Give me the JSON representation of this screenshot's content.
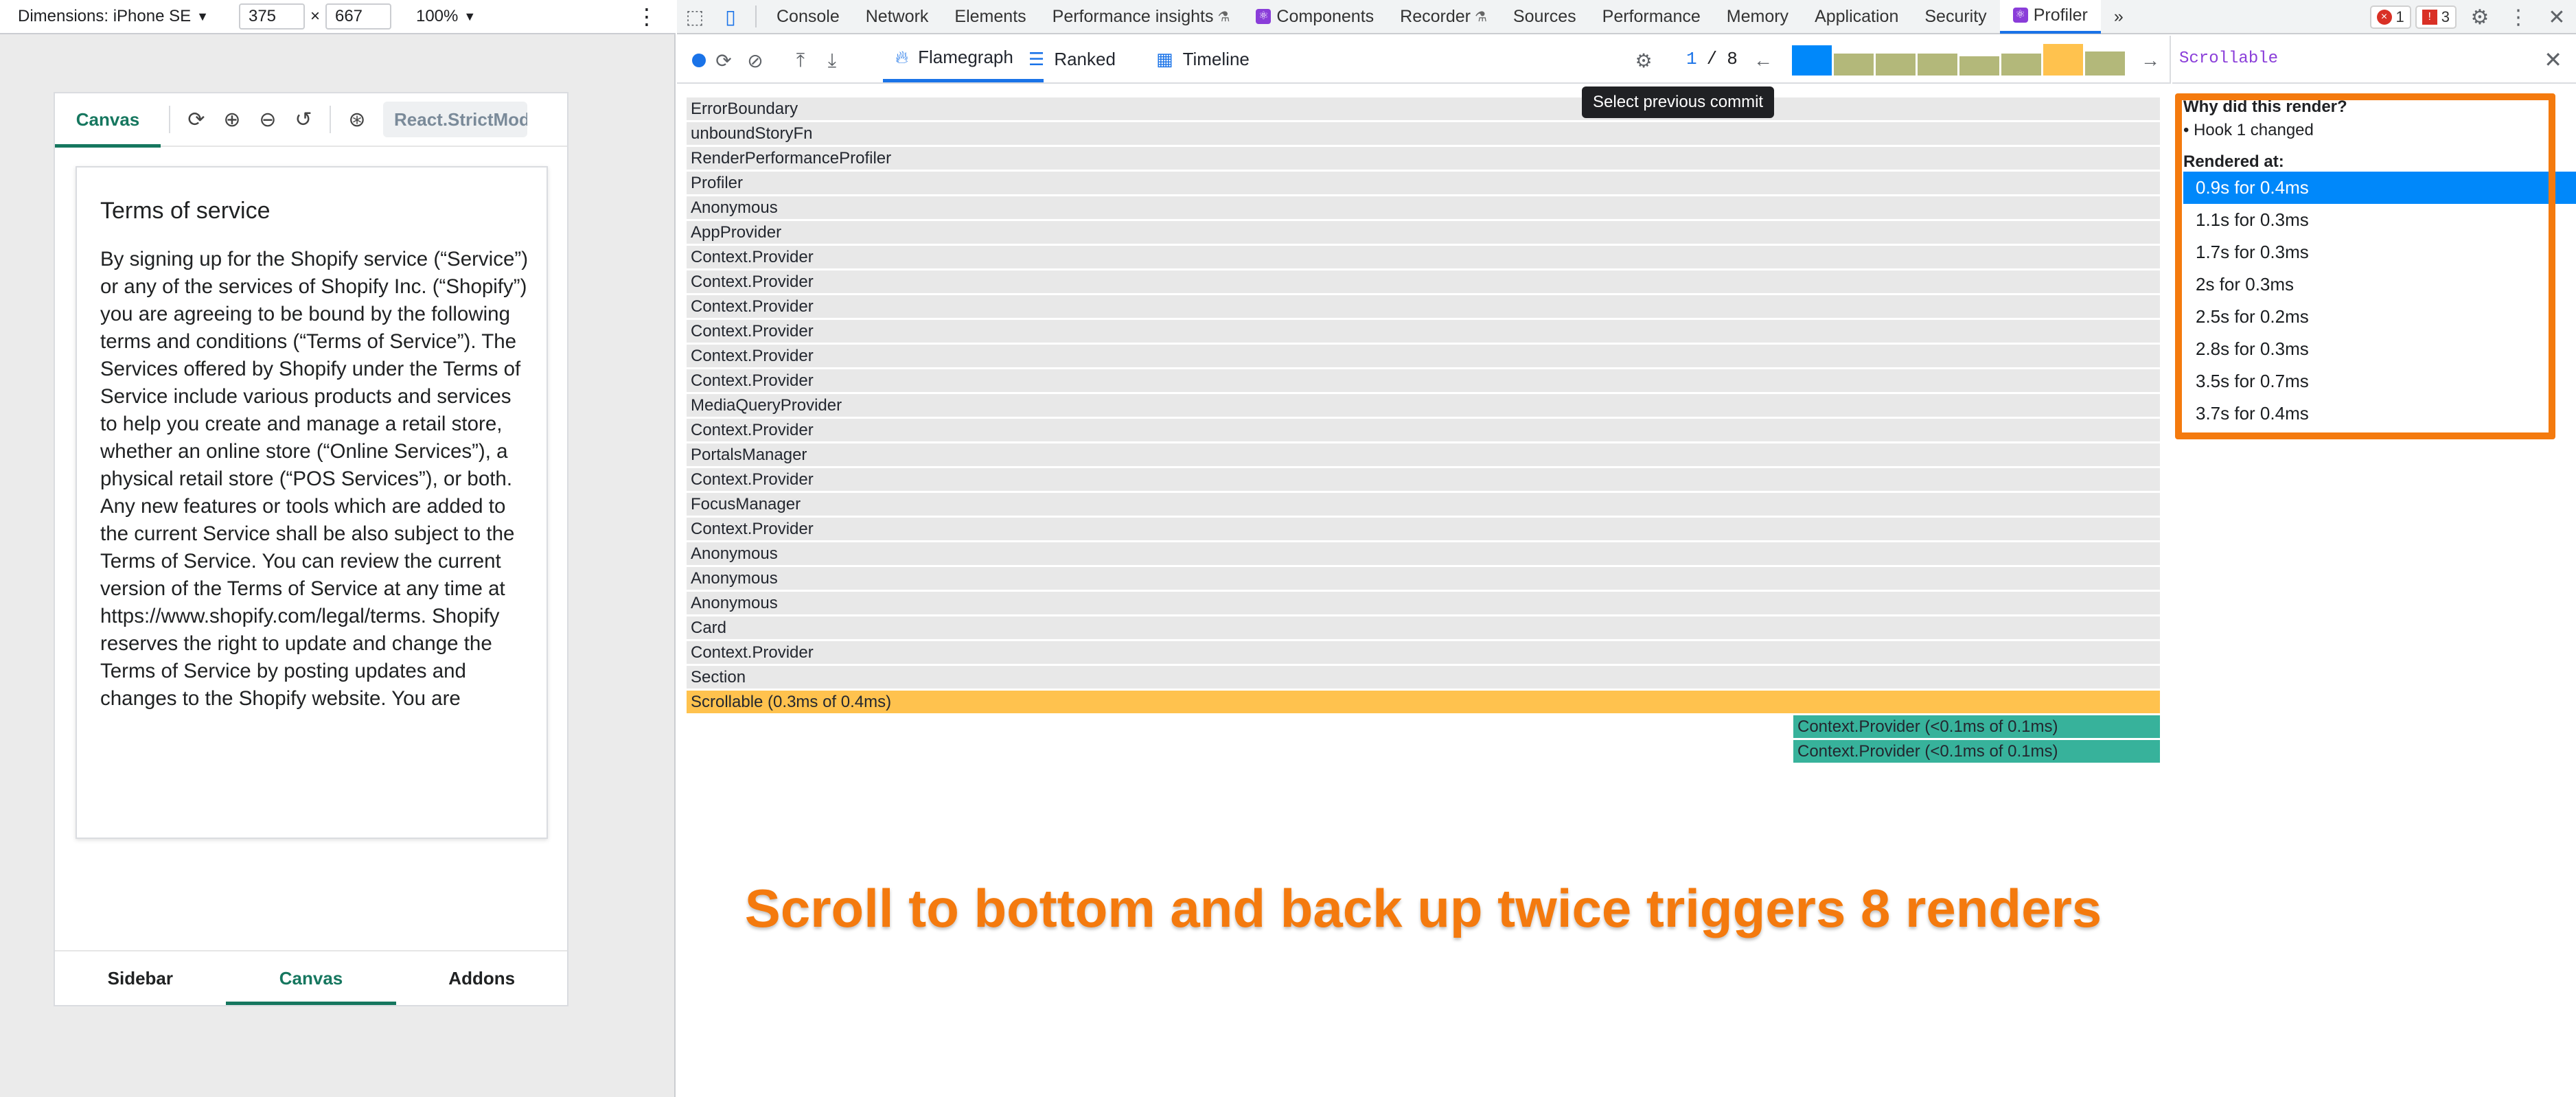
{
  "device_toolbar": {
    "dimensions_label": "Dimensions: iPhone SE",
    "width": "375",
    "height": "667",
    "times": "×",
    "zoom": "100%"
  },
  "storybook": {
    "tab_canvas": "Canvas",
    "strict_mode": "React.StrictMode",
    "story_title": "Terms of service",
    "story_body": "By signing up for the Shopify service (“Service”) or any of the services of Shopify Inc. (“Shopify”) you are agreeing to be bound by the following terms and conditions (“Terms of Service”). The Services offered by Shopify under the Terms of Service include various products and services to help you create and manage a retail store, whether an online store (“Online Services”), a physical retail store (“POS Services”), or both. Any new features or tools which are added to the current Service shall be also subject to the Terms of Service. You can review the current version of the Terms of Service at any time at https://www.shopify.com/legal/terms. Shopify reserves the right to update and change the Terms of Service by posting updates and changes to the Shopify website. You are",
    "nav": [
      "Sidebar",
      "Canvas",
      "Addons"
    ]
  },
  "devtools": {
    "tabs": [
      "Console",
      "Network",
      "Elements",
      "Performance insights",
      "Components",
      "Recorder",
      "Sources",
      "Performance",
      "Memory",
      "Application",
      "Security",
      "Profiler"
    ],
    "more": "»",
    "error_count": "1",
    "warning_count": "3"
  },
  "profiler": {
    "tab_flamegraph": "Flamegraph",
    "tab_ranked": "Ranked",
    "tab_timeline": "Timeline",
    "commit_current": "1",
    "commit_sep": "/",
    "commit_total": "8",
    "tooltip": "Select previous commit",
    "commit_levels": [
      0.95,
      0.7,
      0.7,
      0.7,
      0.6,
      0.7,
      1.0,
      0.75
    ],
    "colors": {
      "selected_commit": "#0088fa",
      "commit": "#b3b87a",
      "commit_max": "#ffc24e",
      "flame_parent": "#e8e8e8",
      "flame_selected": "#ffc24e",
      "flame_child": "#37b29b",
      "annotation": "#f47a0e"
    },
    "flame_rows": [
      "ErrorBoundary",
      "unboundStoryFn",
      "RenderPerformanceProfiler",
      "Profiler",
      "Anonymous",
      "AppProvider",
      "Context.Provider",
      "Context.Provider",
      "Context.Provider",
      "Context.Provider",
      "Context.Provider",
      "Context.Provider",
      "MediaQueryProvider",
      "Context.Provider",
      "PortalsManager",
      "Context.Provider",
      "FocusManager",
      "Context.Provider",
      "Anonymous",
      "Anonymous",
      "Anonymous",
      "Card",
      "Context.Provider",
      "Section"
    ],
    "selected_row": "Scrollable (0.3ms of 0.4ms)",
    "child_rows": [
      "Context.Provider (<0.1ms of 0.1ms)",
      "Context.Provider (<0.1ms of 0.1ms)"
    ]
  },
  "annotation": "Scroll to bottom and back up twice triggers 8 renders",
  "sidebar": {
    "title": "Scrollable",
    "why_label": "Why did this render?",
    "reason": "• Hook 1 changed",
    "rendered_label": "Rendered at:",
    "renders": [
      "0.9s for 0.4ms",
      "1.1s for 0.3ms",
      "1.7s for 0.3ms",
      "2s for 0.3ms",
      "2.5s for 0.2ms",
      "2.8s for 0.3ms",
      "3.5s for 0.7ms",
      "3.7s for 0.4ms"
    ]
  }
}
